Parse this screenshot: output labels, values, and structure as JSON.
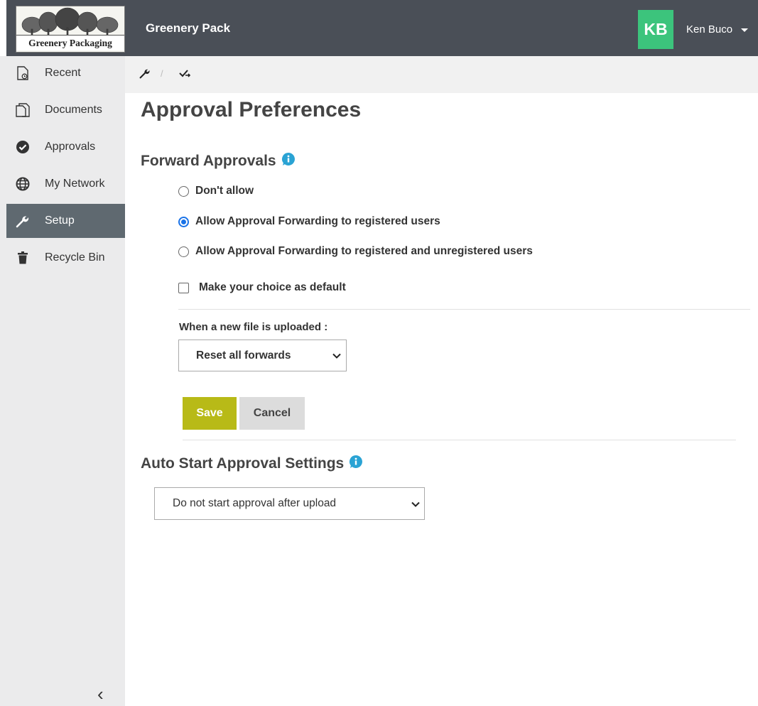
{
  "header": {
    "logo_text": "Greenery Packaging",
    "app_title": "Greenery Pack",
    "user": {
      "initials": "KB",
      "name": "Ken Buco",
      "avatar_color": "#3cc47c"
    }
  },
  "sidebar": {
    "items": [
      {
        "label": "Recent",
        "icon": "recent-document-icon",
        "active": false
      },
      {
        "label": "Documents",
        "icon": "documents-icon",
        "active": false
      },
      {
        "label": "Approvals",
        "icon": "check-circle-icon",
        "active": false
      },
      {
        "label": "My Network",
        "icon": "globe-icon",
        "active": false
      },
      {
        "label": "Setup",
        "icon": "wrench-icon",
        "active": true
      },
      {
        "label": "Recycle Bin",
        "icon": "trash-icon",
        "active": false
      }
    ],
    "collapse_glyph": "‹"
  },
  "breadcrumb": {
    "separator": "/"
  },
  "page": {
    "title": "Approval Preferences"
  },
  "forward_approvals": {
    "title": "Forward Approvals",
    "options": [
      {
        "label": "Don't allow",
        "checked": false
      },
      {
        "label": "Allow Approval Forwarding to registered users",
        "checked": true
      },
      {
        "label": "Allow Approval Forwarding to registered and unregistered users",
        "checked": false
      }
    ],
    "default_checkbox_label": "Make your choice as default",
    "default_checked": false,
    "upload_label": "When a new file is uploaded :",
    "upload_select_value": "Reset all forwards",
    "save_label": "Save",
    "cancel_label": "Cancel"
  },
  "auto_start": {
    "title": "Auto Start Approval Settings",
    "select_value": "Do not start approval after upload"
  },
  "colors": {
    "topbar": "#4a4f57",
    "sidebar": "#ebebec",
    "sidebar_active": "#5f6970",
    "save_button": "#b8ba17",
    "info_icon": "#2aa3d4",
    "radio_checked": "#1a73e8"
  }
}
